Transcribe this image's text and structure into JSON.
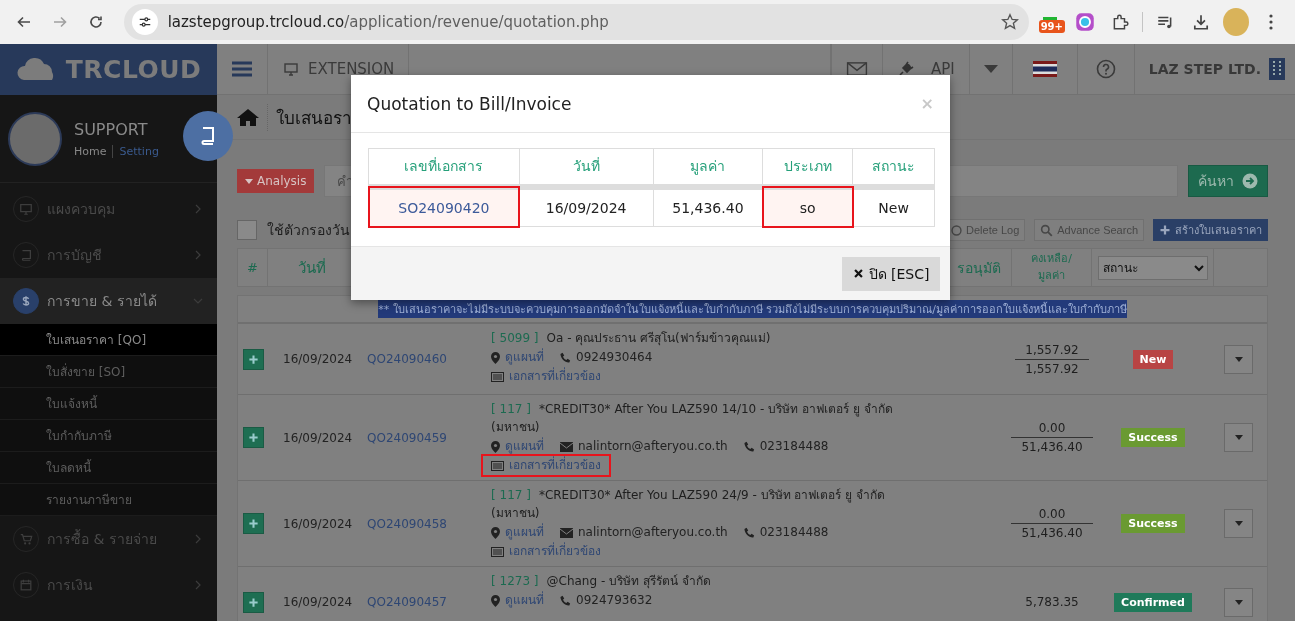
{
  "browser": {
    "url_host": "lazstepgroup.trcloud.co",
    "url_path": "/application/revenue/quotation.php",
    "extension_badge": "99+"
  },
  "app_header": {
    "logo": "TRCLOUD",
    "extension": "EXTENSION",
    "api": "API",
    "company": "LAZ STEP LTD."
  },
  "sidebar": {
    "user": "SUPPORT",
    "home_link": "Home",
    "setting_link": "Setting",
    "items": [
      {
        "label": "แผงควบคุม",
        "selected": false,
        "expanded": false
      },
      {
        "label": "การบัญชี",
        "selected": false,
        "expanded": false
      },
      {
        "label": "การขาย & รายได้",
        "selected": true,
        "expanded": true,
        "children": [
          {
            "label": "ใบเสนอราคา [QO]",
            "selected": true
          },
          {
            "label": "ใบสั่งขาย [SO]",
            "selected": false
          },
          {
            "label": "ใบแจ้งหนี้",
            "selected": false
          },
          {
            "label": "ใบกำกับภาษี",
            "selected": false
          },
          {
            "label": "ใบลดหนี้",
            "selected": false
          },
          {
            "label": "รายงานภาษีขาย",
            "selected": false
          }
        ]
      },
      {
        "label": "การซื้อ & รายจ่าย",
        "selected": false,
        "expanded": false
      },
      {
        "label": "การเงิน",
        "selected": false,
        "expanded": false
      }
    ]
  },
  "page": {
    "title": "ใบเสนอรา",
    "analysis_button": "Analysis",
    "search": {
      "placeholder": "คำ"
    },
    "search_button": "ค้นหา",
    "date_filter": {
      "label": "ใช้ตัวกรองวัน",
      "checked": false
    },
    "toolbar": [
      "Delete Log",
      "Advance Search",
      "สร้างใบเสนอราคา"
    ]
  },
  "table": {
    "columns": [
      "#",
      "วันที่",
      "รอนุมัติ",
      "คงเหลือ/มูลค่า"
    ],
    "status_filter": "สถานะ",
    "notice": "** ใบเสนอราคาจะไม่มีระบบจะควบคุมการออกมัดจำในใบแจ้งหนี้และใบกำกับภาษี รวมถึงไม่มีระบบการควบคุมปริมาณ/มูลค่าการออกใบแจ้งหนี้และใบกำกับภาษี",
    "rows": [
      {
        "date": "16/09/2024",
        "doc_no": "QO24090460",
        "code": "[ 5099 ]",
        "customer": "Oa - คุณประธาน ศรีสุโน(ฟาร์มข้าวคุณแม่)",
        "contacts": [
          {
            "kind": "map",
            "text": "ดูแผนที่"
          },
          {
            "kind": "phone",
            "text": "0924930464"
          }
        ],
        "related_docs": "เอกสารที่เกี่ยวข้อง",
        "remaining": "1,557.92",
        "total": "1,557.92",
        "status": "New",
        "color": "#b84444"
      },
      {
        "date": "16/09/2024",
        "doc_no": "QO24090459",
        "code": "[ 117 ]",
        "customer": "*CREDIT30* After You LAZ590 14/10 - บริษัท อาฟเตอร์ ยู จำกัด (มหาชน)",
        "contacts": [
          {
            "kind": "map",
            "text": "ดูแผนที่"
          },
          {
            "kind": "email",
            "text": "nalintorn@afteryou.co.th"
          },
          {
            "kind": "phone",
            "text": "023184488"
          }
        ],
        "related_docs": "เอกสารที่เกี่ยวข้อง",
        "docs_highlighted": true,
        "remaining": "0.00",
        "total": "51,436.40",
        "status": "Success",
        "color": "#6a9a32"
      },
      {
        "date": "16/09/2024",
        "doc_no": "QO24090458",
        "code": "[ 117 ]",
        "customer": "*CREDIT30* After You LAZ590 24/9 - บริษัท อาฟเตอร์ ยู จำกัด (มหาชน)",
        "contacts": [
          {
            "kind": "map",
            "text": "ดูแผนที่"
          },
          {
            "kind": "email",
            "text": "nalintorn@afteryou.co.th"
          },
          {
            "kind": "phone",
            "text": "023184488"
          }
        ],
        "related_docs": "เอกสารที่เกี่ยวข้อง",
        "remaining": "0.00",
        "total": "51,436.40",
        "status": "Success",
        "color": "#6a9a32"
      },
      {
        "date": "16/09/2024",
        "doc_no": "QO24090457",
        "code": "[ 1273 ]",
        "customer": "@Chang - บริษัท สุรีรัตน์ จำกัด",
        "contacts": [
          {
            "kind": "map",
            "text": "ดูแผนที่"
          },
          {
            "kind": "phone",
            "text": "0924793632"
          }
        ],
        "remaining": "5,783.35",
        "status": "Confirmed",
        "color": "#1f7a5a"
      }
    ]
  },
  "modal": {
    "title": "Quotation to Bill/Invoice",
    "close": "×",
    "columns": [
      "เลขที่เอกสาร",
      "วันที่",
      "มูลค่า",
      "ประเภท",
      "สถานะ"
    ],
    "rows": [
      {
        "cells": [
          {
            "kind": "link",
            "text": "SO24090420",
            "highlighted": true
          },
          {
            "kind": "text",
            "text": "16/09/2024",
            "highlighted": false
          },
          {
            "kind": "text",
            "text": "51,436.40",
            "highlighted": false
          },
          {
            "kind": "text",
            "text": "so",
            "highlighted": true
          },
          {
            "kind": "text",
            "text": "New",
            "highlighted": false
          }
        ]
      }
    ],
    "close_button": "ปิด [ESC]"
  }
}
